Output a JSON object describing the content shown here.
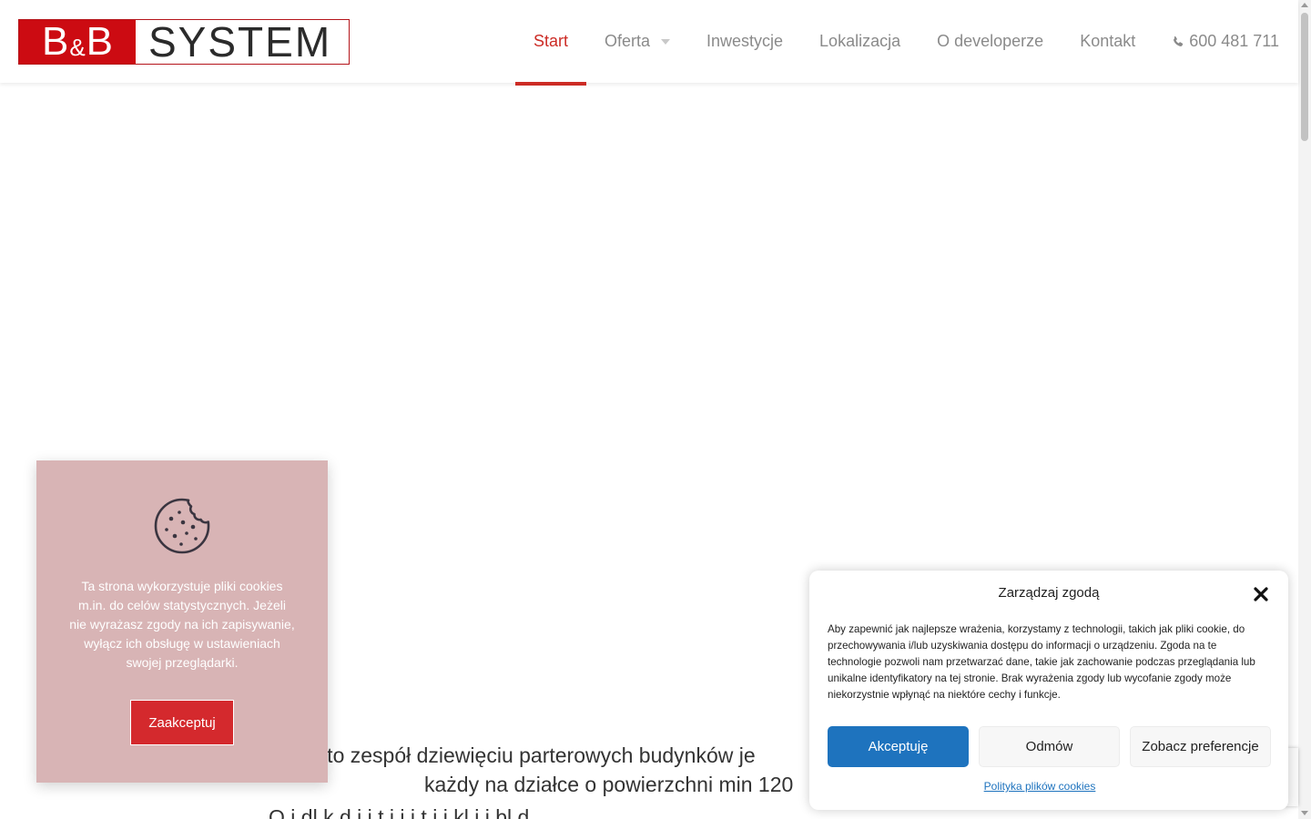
{
  "logo": {
    "left_text": "B&B",
    "left_b1": "B",
    "left_amp": "&",
    "left_b2": "B",
    "right_text": "SYSTEM"
  },
  "nav": {
    "items": [
      {
        "label": "Start",
        "active": true
      },
      {
        "label": "Oferta",
        "has_dropdown": true
      },
      {
        "label": "Inwestycje"
      },
      {
        "label": "Lokalizacja"
      },
      {
        "label": "O developerze"
      },
      {
        "label": "Kontakt"
      }
    ],
    "phone": "600 481 711"
  },
  "intro": {
    "line1": "e to  zespół dziewięciu parterowych budynków je",
    "line2": "każdy na działce o powierzchni min 120",
    "line3": "O i dl  k d  i  i  t  i  i  i  t  i  i kl i i  bl d"
  },
  "cookie_card": {
    "text": "Ta strona wykorzystuje pliki cookies m.in. do celów statystycznych. Jeżeli nie wyrażasz zgody na ich zapisywanie, wyłącz ich obsługę w ustawieniach swojej przeglądarki.",
    "button": "Zaakceptuj"
  },
  "consent": {
    "title": "Zarządzaj zgodą",
    "text": "Aby zapewnić jak najlepsze wrażenia, korzystamy z technologii, takich jak pliki cookie, do przechowywania i/lub uzyskiwania dostępu do informacji o urządzeniu. Zgoda na te technologie pozwoli nam przetwarzać dane, takie jak zachowanie podczas przeglądania lub unikalne identyfikatory na tej stronie. Brak wyrażenia zgody lub wycofanie zgody może niekorzystnie wpłynąć na niektóre cechy i funkcje.",
    "accept": "Akceptuję",
    "deny": "Odmów",
    "preferences": "Zobacz preferencje",
    "policy_link": "Polityka plików cookies"
  },
  "colors": {
    "brand_red": "#cc0b12",
    "nav_active": "#cc2b25",
    "accept_blue": "#1e73be",
    "cookie_card_bg": "#d8b4b5"
  },
  "icons": {
    "phone": "phone-icon",
    "cookie": "cookie-icon",
    "close": "close-icon",
    "dropdown": "chevron-down-icon"
  }
}
